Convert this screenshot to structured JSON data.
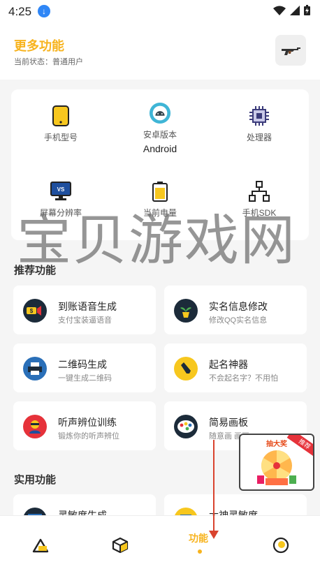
{
  "status_bar": {
    "time": "4:25"
  },
  "header": {
    "title": "更多功能",
    "subtitle": "当前状态：普通用户"
  },
  "device_info": [
    {
      "label": "手机型号",
      "value": "",
      "icon": "phone-icon"
    },
    {
      "label": "安卓版本",
      "value": "Android",
      "icon": "android-icon"
    },
    {
      "label": "处理器",
      "value": "",
      "icon": "cpu-icon"
    },
    {
      "label": "屏幕分辨率",
      "value": "",
      "icon": "monitor-icon"
    },
    {
      "label": "当前电量",
      "value": "",
      "icon": "battery-icon"
    },
    {
      "label": "手机SDK",
      "value": "",
      "icon": "network-icon"
    }
  ],
  "watermark": "宝贝游戏网",
  "recommended": {
    "title": "推荐功能",
    "items": [
      {
        "name": "到账语音生成",
        "desc": "支付宝装逼语音",
        "icon": "money-speaker-icon"
      },
      {
        "name": "实名信息修改",
        "desc": "修改QQ实名信息",
        "icon": "plant-icon"
      },
      {
        "name": "二维码生成",
        "desc": "一键生成二维码",
        "icon": "printer-icon"
      },
      {
        "name": "起名神器",
        "desc": "不会起名字？不用怕",
        "icon": "pen-icon"
      },
      {
        "name": "听声辨位训练",
        "desc": "锻炼你的听声辨位",
        "icon": "person-icon"
      },
      {
        "name": "简易画板",
        "desc": "随意画 画画~",
        "icon": "palette-icon"
      }
    ]
  },
  "practical": {
    "title": "实用功能",
    "items": [
      {
        "name": "灵敏度生成",
        "icon": "screen-icon"
      },
      {
        "name": "大神灵敏度",
        "icon": "book-icon"
      }
    ]
  },
  "float_ad": {
    "title": "抽大奖",
    "tag": "推荐"
  },
  "tabbar": {
    "active_label": "功能",
    "tabs": [
      "home-icon",
      "cube-icon",
      "function-tab",
      "profile-icon"
    ]
  },
  "colors": {
    "accent": "#f7b31e",
    "arrow": "#d9432e"
  }
}
